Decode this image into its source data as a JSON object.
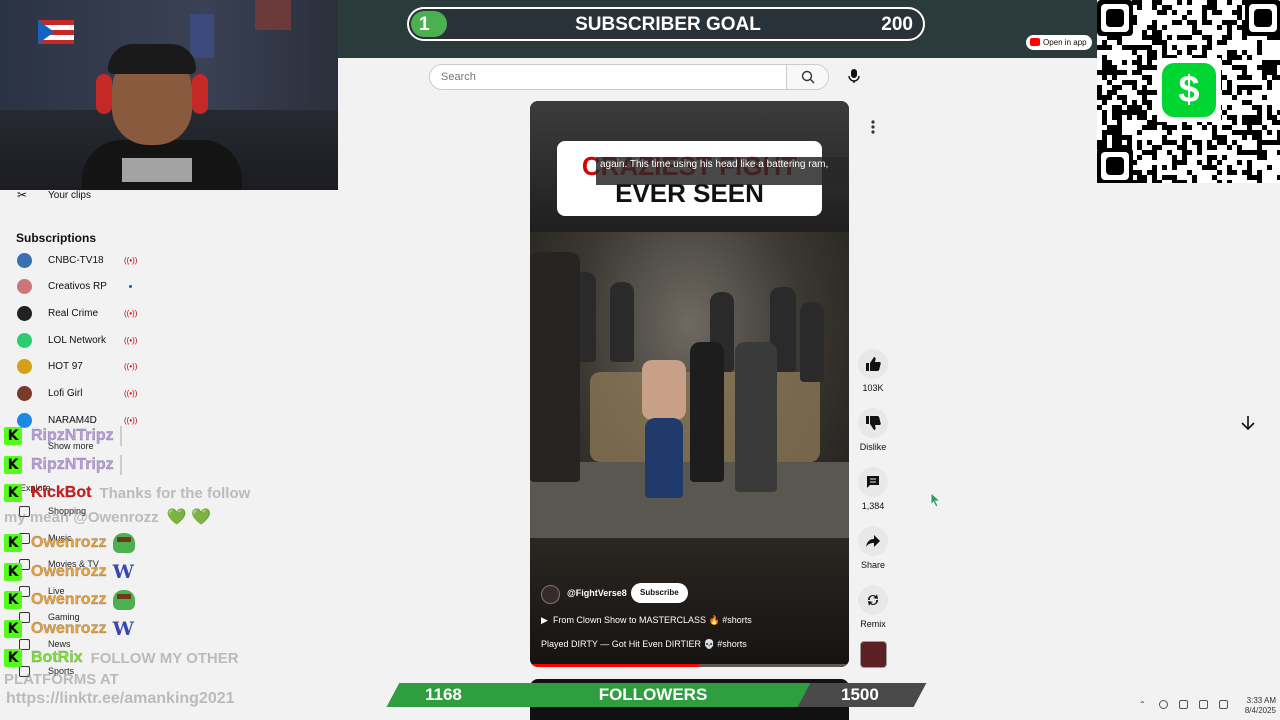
{
  "subscriber_goal": {
    "title": "SUBSCRIBER GOAL",
    "current": "1",
    "target": "200",
    "progress": 0.005
  },
  "followers_goal": {
    "title": "FOLLOWERS",
    "current": "1168",
    "target": "1500",
    "progress": 0.78
  },
  "search": {
    "placeholder": "Search"
  },
  "open_in_app": "Open in app",
  "sidebar": {
    "your_clips": "Your clips",
    "subscriptions_heading": "Subscriptions",
    "channels": [
      {
        "name": "CNBC-TV18",
        "status": "live",
        "color": "#3a6fb0"
      },
      {
        "name": "Creativos RP",
        "status": "new",
        "color": "#c77"
      },
      {
        "name": "Real Crime",
        "status": "live",
        "color": "#222"
      },
      {
        "name": "LOL Network",
        "status": "live",
        "color": "#2ecc71"
      },
      {
        "name": "HOT 97",
        "status": "live",
        "color": "#d4a017"
      },
      {
        "name": "Lofi Girl",
        "status": "live",
        "color": "#7a3a2a"
      },
      {
        "name": "NARAM4D",
        "status": "live",
        "color": "#1e88e5"
      }
    ],
    "show_more": "Show more",
    "explore": "Explore",
    "nav": [
      "Shopping",
      "Music",
      "Movies & TV",
      "Live",
      "Gaming",
      "News",
      "Sports"
    ]
  },
  "chat": [
    {
      "user": "RipzNTripz",
      "color": "#b9a0e0",
      "message": ""
    },
    {
      "user": "RipzNTripz",
      "color": "#b9a0e0",
      "message": ""
    },
    {
      "user": "KickBot",
      "color": "#d61a1a",
      "message": "Thanks for the follow"
    },
    {
      "user": "Owenrozz",
      "color": "#e8a33d",
      "message": "",
      "emote": "frog"
    },
    {
      "user": "Owenrozz",
      "color": "#e8a33d",
      "message": "",
      "emote": "W"
    },
    {
      "user": "Owenrozz",
      "color": "#e8a33d",
      "message": "",
      "emote": "frog"
    },
    {
      "user": "Owenrozz",
      "color": "#e8a33d",
      "message": "",
      "emote": "W"
    },
    {
      "user": "BotRix",
      "color": "#7fe33b",
      "message": "FOLLOW MY OTHER"
    }
  ],
  "chat_extra": {
    "line2": "my mean @Owenrozz",
    "hearts": "💚 💚",
    "platforms": "PLATFORMS AT",
    "link": "https://linktr.ee/amanking2021"
  },
  "short": {
    "title_line1": "CRAZIEST FIGHT",
    "title_line2": "EVER SEEN",
    "caption": "again. This time using his head like a battering ram,",
    "channel": "@FightVerse8",
    "subscribe": "Subscribe",
    "playlist": "From Clown Show to MASTERCLASS 🔥 #shorts",
    "video_title": "Played DIRTY — Got Hit Even DIRTIER 💀 #shorts",
    "progress": 0.53
  },
  "actions": {
    "likes": "103K",
    "dislike": "Dislike",
    "comments": "1,384",
    "share": "Share",
    "remix": "Remix"
  },
  "taskbar": {
    "time": "3:33 AM",
    "date": "8/4/2025"
  },
  "colors": {
    "goal_green": "#4caf50",
    "cashapp": "#00d632",
    "kick": "#53fc18"
  }
}
